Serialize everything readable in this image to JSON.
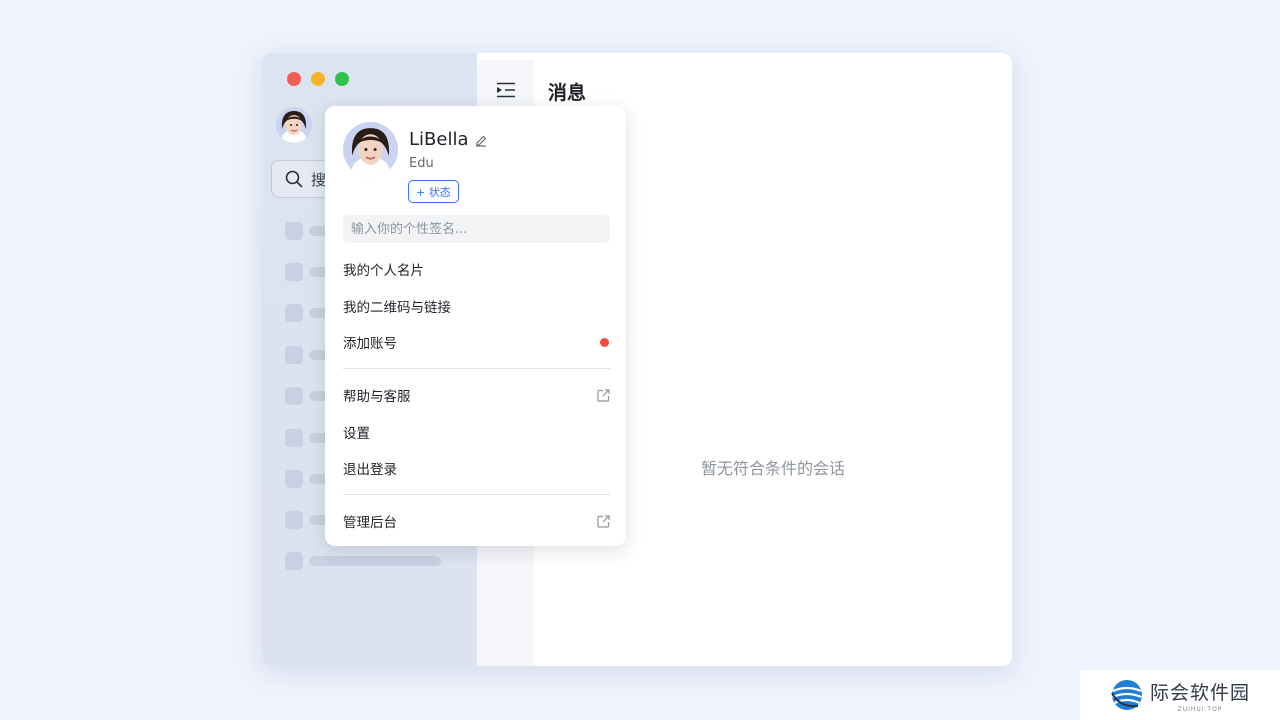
{
  "sidebar": {
    "search_glyph": "搜",
    "skeleton_rows": 9
  },
  "main": {
    "title": "消息",
    "empty_text": "暂无符合条件的会话"
  },
  "profile": {
    "name": "LiBella",
    "org": "Edu",
    "status_label": "+ 状态",
    "signature_placeholder": "输入你的个性签名..."
  },
  "menu": {
    "items": [
      {
        "label": "我的个人名片"
      },
      {
        "label": "我的二维码与链接"
      },
      {
        "label": "添加账号",
        "badge": "red-dot"
      },
      {
        "label": "帮助与客服",
        "icon": "external-link-icon"
      },
      {
        "label": "设置"
      },
      {
        "label": "退出登录"
      },
      {
        "label": "管理后台",
        "icon": "external-link-icon"
      }
    ]
  },
  "watermark": {
    "name": "际会软件园",
    "sub": "ZUIHUI.TOP"
  },
  "colors": {
    "accent": "#3370ff",
    "badge_red": "#f54a45",
    "traffic_red": "#f25c54",
    "traffic_yellow": "#f6b32a",
    "traffic_green": "#2fc14b"
  }
}
